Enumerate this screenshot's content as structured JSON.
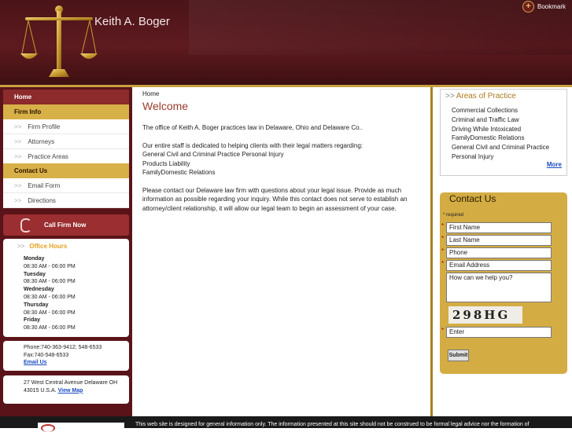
{
  "header": {
    "title": "Keith A. Boger",
    "bookmark_label": "Bookmark"
  },
  "nav": {
    "home": "Home",
    "firm_info": "Firm Info",
    "firm_profile": "Firm Profile",
    "attorneys": "Attorneys",
    "practice_areas": "Practice Areas",
    "contact_us": "Contact Us",
    "email_form": "Email Form",
    "directions": "Directions",
    "arrow": ">>"
  },
  "call": {
    "label": "Call Firm Now"
  },
  "office_hours": {
    "title": "Office Hours",
    "days": [
      {
        "day": "Monday",
        "hours": "08:30 AM - 06:00 PM"
      },
      {
        "day": "Tuesday",
        "hours": "08:30 AM - 06:00 PM"
      },
      {
        "day": "Wednesday",
        "hours": "08:30 AM - 06:00 PM"
      },
      {
        "day": "Thursday",
        "hours": "08:30 AM - 06:00 PM"
      },
      {
        "day": "Friday",
        "hours": "08:30 AM - 06:00 PM"
      }
    ]
  },
  "contact_info": {
    "phone": "Phone:740-363-9412; 548-6533",
    "fax": "Fax:740-548-6533",
    "email_link": "Email Us"
  },
  "address": {
    "line1": "27 West Central Avenue Delaware OH",
    "line2": "43015 U.S.A.",
    "map_link": "View Map"
  },
  "main": {
    "breadcrumb": "Home",
    "heading": "Welcome",
    "p1": "The office of Keith A. Boger practices law in Delaware, Ohio and Delaware Co..",
    "p2_intro": "Our entire staff is dedicated to helping clients with their legal matters regarding:",
    "p2_items": [
      "General Civil and Criminal Practice Personal Injury",
      "Products Liability",
      "FamilyDomestic Relations"
    ],
    "p3": "Please contact our Delaware law firm with questions about your legal issue. Provide as much information as possible regarding your inquiry. While this contact does not serve to establish an attorney/client relationship, it will allow our legal team to begin an assessment of your case."
  },
  "areas": {
    "title": "Areas of Practice",
    "items": [
      "Commercial Collections",
      "Criminal and Traffic Law",
      "Driving While Intoxicated",
      "FamilyDomestic Relations",
      "General Civil and Criminal Practice",
      "Personal Injury"
    ],
    "more": "More"
  },
  "contact_form": {
    "title": "Contact Us",
    "required": "* required",
    "first_name": "First Name",
    "last_name": "Last Name",
    "phone": "Phone",
    "email": "Email Address",
    "message": "How can we help you?",
    "captcha": "298HG",
    "captcha_input": "Enter",
    "submit": "Submit"
  },
  "footer": {
    "disclaimer": "This web site is designed for general information only. The information presented at this site should not be construed to be formal legal advice nor the formation of"
  }
}
